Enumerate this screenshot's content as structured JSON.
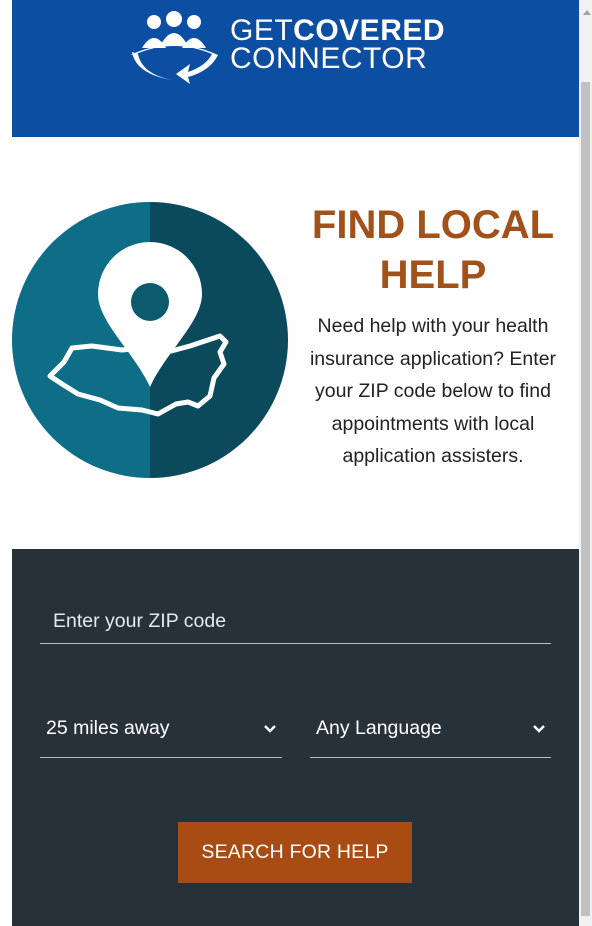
{
  "header": {
    "logo_alt": "GetCovered Connector",
    "line1_light": "GET",
    "line1_bold": "COVERED",
    "line2": "CONNECTOR"
  },
  "hero": {
    "title": "FIND LOCAL HELP",
    "description": "Need help with your health insurance application? Enter your ZIP code below to find appointments with local application assisters."
  },
  "search": {
    "zip_placeholder": "Enter your ZIP code",
    "zip_value": "",
    "distance_selected": "25 miles away",
    "language_selected": "Any Language",
    "submit_label": "SEARCH FOR HELP"
  },
  "colors": {
    "header_blue": "#0b4ea2",
    "title_orange": "#a0521a",
    "panel_dark": "#273139",
    "button_orange": "#a84c13",
    "icon_teal_light": "#0e6e88",
    "icon_teal_dark": "#0a4a5c"
  },
  "icons": [
    "logo-people-icon",
    "map-pin-icon",
    "usa-outline-icon",
    "chevron-down-icon"
  ]
}
